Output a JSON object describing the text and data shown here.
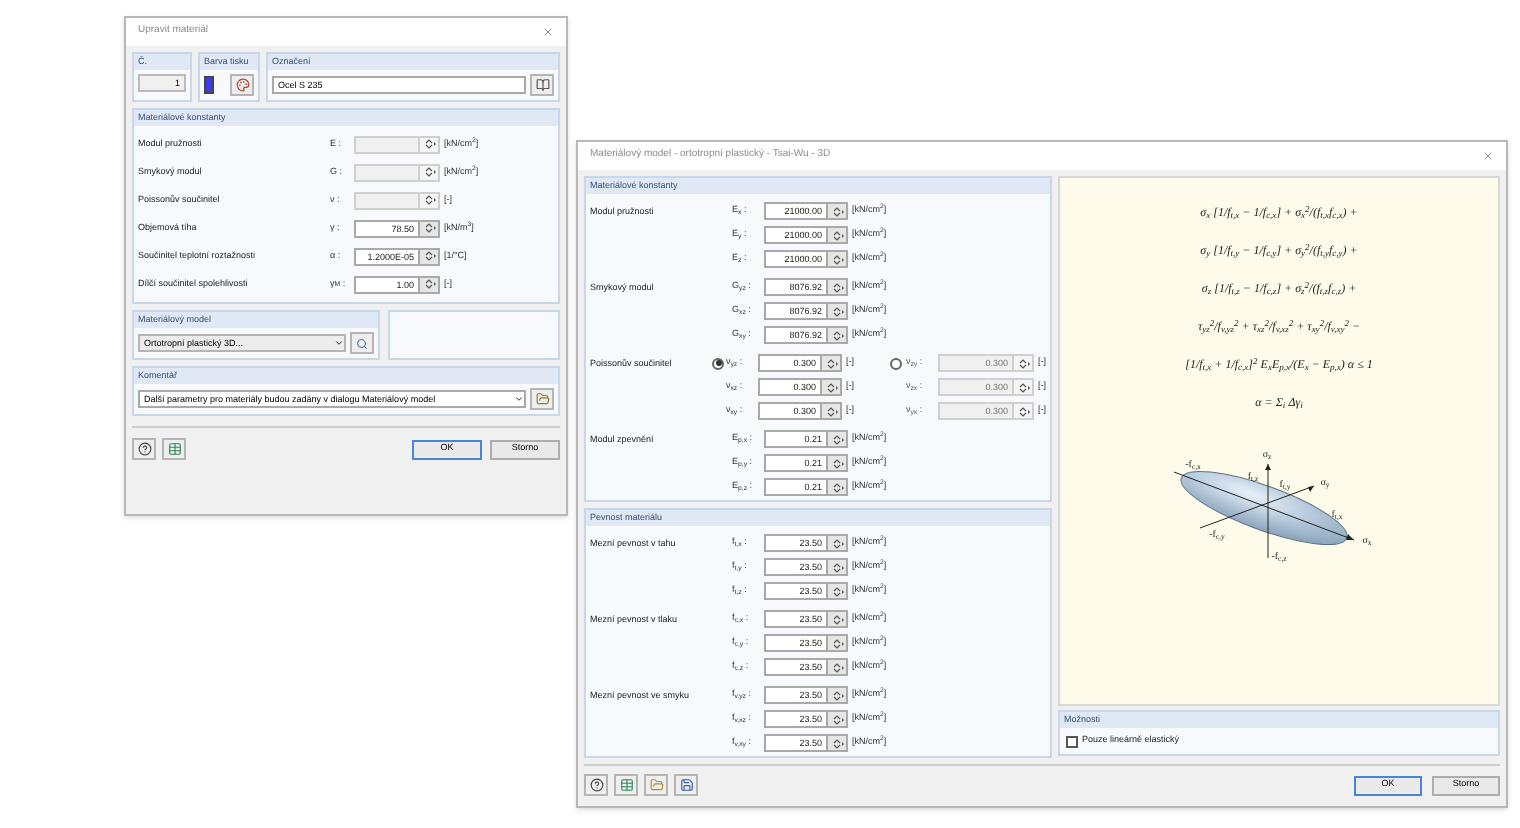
{
  "left_dialog": {
    "title": "Upravit materiál",
    "number": {
      "label": "Č.",
      "value": "1"
    },
    "print_color": {
      "label": "Barva tisku",
      "color": "#3b3bf0"
    },
    "designation": {
      "label": "Označení",
      "value": "Ocel S 235"
    },
    "constants": {
      "title": "Materiálové konstanty",
      "rows": [
        {
          "label": "Modul pružnosti",
          "symbol": "E :",
          "unit": "[kN/cm$^{2}$]",
          "disabled": true
        },
        {
          "label": "Smykový modul",
          "symbol": "G :",
          "unit": "[kN/cm$^{2}$]",
          "disabled": true
        },
        {
          "label": "Poissonův součinitel",
          "symbol": "ν :",
          "unit": "[-]",
          "disabled": true
        },
        {
          "label": "Objemová tíha",
          "symbol": "γ :",
          "value": "78.50",
          "unit": "[kN/m$^{3}$]",
          "disabled": false
        },
        {
          "label": "Součinitel teplotní roztažnosti",
          "symbol": "α :",
          "value": "1.2000E-05",
          "unit": "[1/°C]",
          "disabled": false
        },
        {
          "label": "Dílčí součinitel spolehlivosti",
          "symbol": "γ$_{M}$ :",
          "value": "1.00",
          "unit": "[-]",
          "disabled": false
        }
      ]
    },
    "model": {
      "title": "Materiálový model",
      "value": "Ortotropní plastický 3D..."
    },
    "comment": {
      "title": "Komentář",
      "value": "Další parametry pro materiály budou zadány v dialogu Materiálový model"
    },
    "buttons": [
      "OK",
      "Storno"
    ]
  },
  "right_dialog": {
    "title": "Materiálový model - ortotropní plastický - Tsai-Wu - 3D",
    "groups": [
      {
        "title": "Materiálové konstanty",
        "params": [
          {
            "label": "Modul pružnosti",
            "kind": "standard",
            "rows": [
              {
                "symbol": "E$_{x}$ :",
                "value": "21000.00",
                "unit": "[kN/cm$^{2}$]"
              },
              {
                "symbol": "E$_{y}$ :",
                "value": "21000.00",
                "unit": "[kN/cm$^{2}$]"
              },
              {
                "symbol": "E$_{z}$ :",
                "value": "21000.00",
                "unit": "[kN/cm$^{2}$]"
              }
            ]
          },
          {
            "label": "Smykový modul",
            "kind": "standard",
            "rows": [
              {
                "symbol": "G$_{yz}$ :",
                "value": "8076.92",
                "unit": "[kN/cm$^{2}$]"
              },
              {
                "symbol": "G$_{xz}$ :",
                "value": "8076.92",
                "unit": "[kN/cm$^{2}$]"
              },
              {
                "symbol": "G$_{xy}$ :",
                "value": "8076.92",
                "unit": "[kN/cm$^{2}$]"
              }
            ]
          },
          {
            "label": "Poissonův součinitel",
            "kind": "poisson",
            "options": [
              {
                "selected": true
              },
              {
                "selected": false
              }
            ],
            "rows": [
              {
                "symbol": "ν$_{yz}$ :",
                "value": "0.300",
                "unit": "[-]",
                "alt": {
                  "symbol": "ν$_{zy}$ :",
                  "value": "0.300",
                  "unit": "[-]"
                }
              },
              {
                "symbol": "ν$_{xz}$ :",
                "value": "0.300",
                "unit": "[-]",
                "alt": {
                  "symbol": "ν$_{zx}$ :",
                  "value": "0.300",
                  "unit": "[-]"
                }
              },
              {
                "symbol": "ν$_{xy}$ :",
                "value": "0.300",
                "unit": "[-]",
                "alt": {
                  "symbol": "ν$_{yx}$ :",
                  "value": "0.300",
                  "unit": "[-]"
                }
              }
            ]
          },
          {
            "label": "Modul zpevnění",
            "kind": "standard",
            "rows": [
              {
                "symbol": "E$_{p,x}$ :",
                "value": "0.21",
                "unit": "[kN/cm$^{2}$]"
              },
              {
                "symbol": "E$_{p,y}$ :",
                "value": "0.21",
                "unit": "[kN/cm$^{2}$]"
              },
              {
                "symbol": "E$_{p,z}$ :",
                "value": "0.21",
                "unit": "[kN/cm$^{2}$]"
              }
            ]
          }
        ]
      },
      {
        "title": "Pevnost materiálu",
        "params": [
          {
            "label": "Mezní pevnost v tahu",
            "kind": "standard",
            "rows": [
              {
                "symbol": "f$_{t,x}$ :",
                "value": "23.50",
                "unit": "[kN/cm$^{2}$]"
              },
              {
                "symbol": "f$_{t,y}$ :",
                "value": "23.50",
                "unit": "[kN/cm$^{2}$]"
              },
              {
                "symbol": "f$_{t,z}$ :",
                "value": "23.50",
                "unit": "[kN/cm$^{2}$]"
              }
            ]
          },
          {
            "label": "Mezní pevnost v tlaku",
            "kind": "standard",
            "rows": [
              {
                "symbol": "f$_{c,x}$ :",
                "value": "23.50",
                "unit": "[kN/cm$^{2}$]"
              },
              {
                "symbol": "f$_{c,y}$ :",
                "value": "23.50",
                "unit": "[kN/cm$^{2}$]"
              },
              {
                "symbol": "f$_{c,z}$ :",
                "value": "23.50",
                "unit": "[kN/cm$^{2}$]"
              }
            ]
          },
          {
            "label": "Mezní pevnost ve smyku",
            "kind": "standard",
            "rows": [
              {
                "symbol": "f$_{v,yz}$ :",
                "value": "23.50",
                "unit": "[kN/cm$^{2}$]"
              },
              {
                "symbol": "f$_{v,xz}$ :",
                "value": "23.50",
                "unit": "[kN/cm$^{2}$]"
              },
              {
                "symbol": "f$_{v,xy}$ :",
                "value": "23.50",
                "unit": "[kN/cm$^{2}$]"
              }
            ]
          }
        ]
      }
    ],
    "formula_lines": [
      "σ$_{x}$ [1/f$_{t,x}$ − 1/f$_{c,x}$] + σ$_{x}$$^{2}$/(f$_{t,x}$f$_{c,x}$) +",
      "σ$_{y}$ [1/f$_{t,y}$ − 1/f$_{c,y}$] + σ$_{y}$$^{2}$/(f$_{t,y}$f$_{c,y}$) +",
      "σ$_{z}$ [1/f$_{t,z}$ − 1/f$_{c,z}$] + σ$_{z}$$^{2}$/(f$_{t,z}$f$_{c,z}$) +",
      "τ$_{yz}$$^{2}$/f$_{v,yz}$$^{2}$ + τ$_{xz}$$^{2}$/f$_{v,xz}$$^{2}$ + τ$_{xy}$$^{2}$/f$_{v,xy}$$^{2}$ −",
      "[1/f$_{t,x}$ + 1/f$_{c,x}$]$^{2}$ E$_{x}$E$_{p,x}$/(E$_{x}$ − E$_{p,x}$) α ≤ 1",
      "α = Σ$_{i}$ Δγ$_{i}$"
    ],
    "diagram_labels": [
      "σ$_{z}$",
      "σ$_{y}$",
      "σ$_{x}$",
      "f$_{t,z}$",
      "f$_{t,y}$",
      "f$_{t,x}$",
      "-f$_{c,x}$",
      "-f$_{c,y}$",
      "-f$_{c,z}$"
    ],
    "options": {
      "title": "Možnosti",
      "checkbox": {
        "label": "Pouze lineárně elastický",
        "checked": false
      }
    },
    "buttons": [
      "OK",
      "Storno"
    ]
  }
}
